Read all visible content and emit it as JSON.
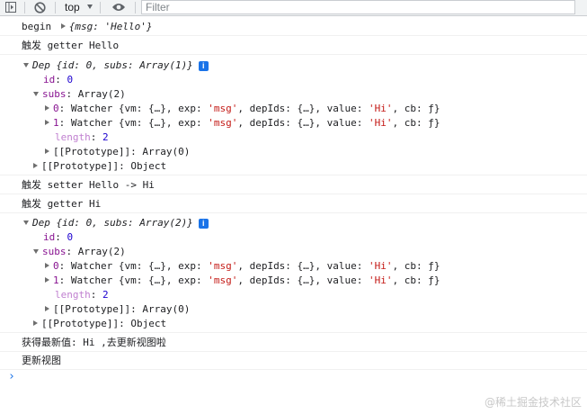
{
  "toolbar": {
    "context": "top",
    "filter_placeholder": "Filter"
  },
  "console": {
    "begin": {
      "label": "begin",
      "obj": "{msg: 'Hello'}"
    },
    "getter1": "触发 getter Hello",
    "dep1": {
      "summary": "Dep {id: 0, subs: Array(1)}",
      "id_key": "id",
      "id_val": "0",
      "subs_key": "subs",
      "subs_type": "Array(2)",
      "watchers": [
        {
          "idx": "0",
          "pre": "Watcher {vm: {…}, exp: ",
          "exp": "'msg'",
          "mid": ", depIds: {…}, value: ",
          "value": "'Hi'",
          "post": ", cb: ƒ}"
        },
        {
          "idx": "1",
          "pre": "Watcher {vm: {…}, exp: ",
          "exp": "'msg'",
          "mid": ", depIds: {…}, value: ",
          "value": "'Hi'",
          "post": ", cb: ƒ}"
        }
      ],
      "length_key": "length",
      "length_val": "2",
      "arr_proto": "[[Prototype]]: Array(0)",
      "obj_proto": "[[Prototype]]: Object"
    },
    "setter": "触发 setter Hello -> Hi",
    "getter2": "触发 getter Hi",
    "dep2": {
      "summary": "Dep {id: 0, subs: Array(2)}",
      "id_key": "id",
      "id_val": "0",
      "subs_key": "subs",
      "subs_type": "Array(2)",
      "watchers": [
        {
          "idx": "0",
          "pre": "Watcher {vm: {…}, exp: ",
          "exp": "'msg'",
          "mid": ", depIds: {…}, value: ",
          "value": "'Hi'",
          "post": ", cb: ƒ}"
        },
        {
          "idx": "1",
          "pre": "Watcher {vm: {…}, exp: ",
          "exp": "'msg'",
          "mid": ", depIds: {…}, value: ",
          "value": "'Hi'",
          "post": ", cb: ƒ}"
        }
      ],
      "length_key": "length",
      "length_val": "2",
      "arr_proto": "[[Prototype]]: Array(0)",
      "obj_proto": "[[Prototype]]: Object"
    },
    "latest": "获得最新值: Hi ,去更新视图啦",
    "update": "更新视图",
    "prompt": "›"
  },
  "watermark": "@稀土掘金技术社区",
  "colors": {
    "accent": "#1a73e8",
    "string": "#c41a16",
    "number": "#1c00cf",
    "key": "#881391"
  },
  "icons": [
    "sidebar-toggle-icon",
    "clear-console-icon",
    "eye-icon",
    "info-icon"
  ]
}
